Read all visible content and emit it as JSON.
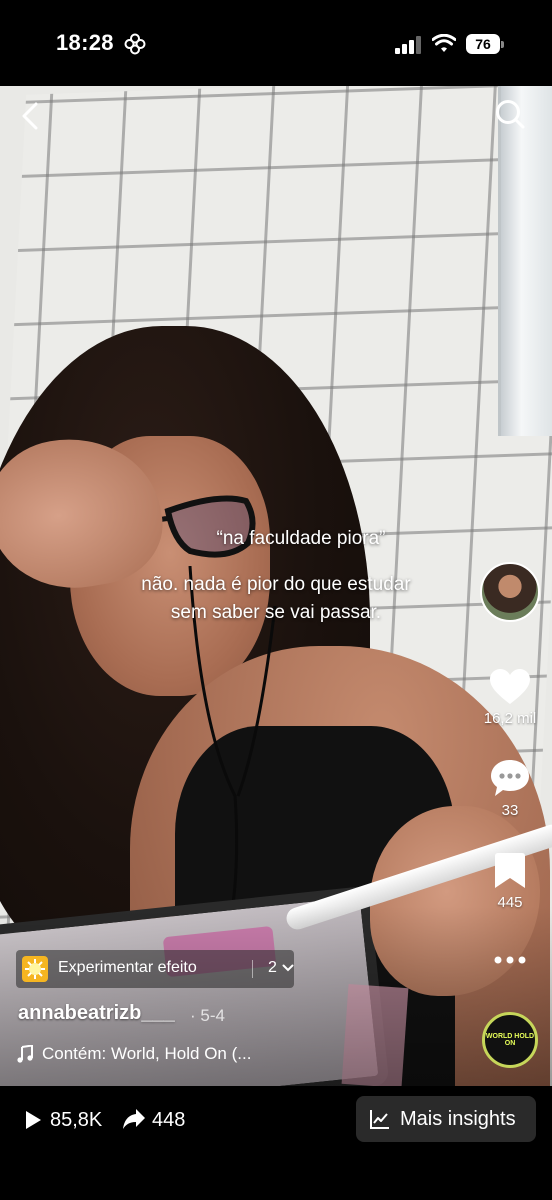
{
  "status_bar": {
    "time": "18:28",
    "battery": "76",
    "icons": [
      "flower-icon",
      "signal-icon",
      "wifi-icon",
      "battery-icon"
    ]
  },
  "nav": {
    "icons": [
      "back-icon",
      "search-icon"
    ]
  },
  "caption": {
    "quote": "“na faculdade piora”",
    "line1": "não. nada é pior do que estudar",
    "line2": "sem saber se vai passar."
  },
  "rail": {
    "likes": "16,2 mil",
    "comments": "33",
    "saves": "445",
    "icons": [
      "heart-icon",
      "comment-icon",
      "bookmark-icon",
      "more-icon"
    ]
  },
  "effect": {
    "label": "Experimentar efeito",
    "count": "2"
  },
  "author": {
    "username": "annabeatrizb___",
    "date": "· 5-4"
  },
  "music": {
    "text": "Contém: World, Hold On (...",
    "disc_label": "WORLD HOLD ON"
  },
  "bottom_bar": {
    "views": "85,8K",
    "shares": "448",
    "insights_label": "Mais insights"
  },
  "colors": {
    "accent_disc": "#c6d65a",
    "effect_thumb": "#f5b521",
    "background": "#000000"
  }
}
